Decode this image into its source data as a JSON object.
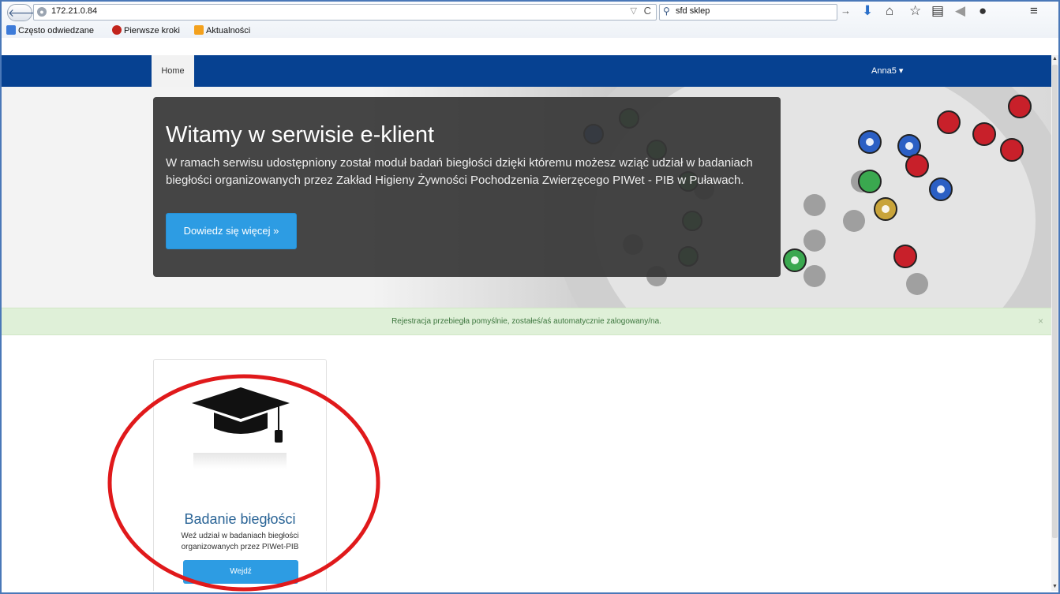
{
  "browser": {
    "url": "172.21.0.84",
    "search_query": "sfd sklep",
    "bookmarks": [
      {
        "label": "Często odwiedzane"
      },
      {
        "label": "Pierwsze kroki"
      },
      {
        "label": "Aktualności"
      }
    ]
  },
  "navbar": {
    "home_label": "Home",
    "user_label": "Anna5",
    "user_caret": "▾",
    "bg_color": "#064191"
  },
  "hero": {
    "title": "Witamy w serwisie e-klient",
    "text": "W ramach serwisu udostępniony został moduł badań biegłości dzięki któremu możesz wziąć udział w badaniach biegłości organizowanych przez Zakład Higieny Żywności Pochodzenia Zwierzęcego PIWet - PIB w Puławach.",
    "button_label": "Dowiedz się więcej »"
  },
  "alert": {
    "message": "Rejestracja przebiegła pomyślnie, zostałeś/aś automatycznie zalogowany/na.",
    "close_glyph": "×"
  },
  "card": {
    "icon": "graduation-cap-icon",
    "title": "Badanie biegłości",
    "description": "Weź udział w badaniach biegłości organizowanych przez PIWet-PIB",
    "button_label": "Wejdź"
  },
  "colors": {
    "accent": "#2d9ce3",
    "annotation": "#e0191b",
    "alert_bg": "#dff0d8"
  }
}
